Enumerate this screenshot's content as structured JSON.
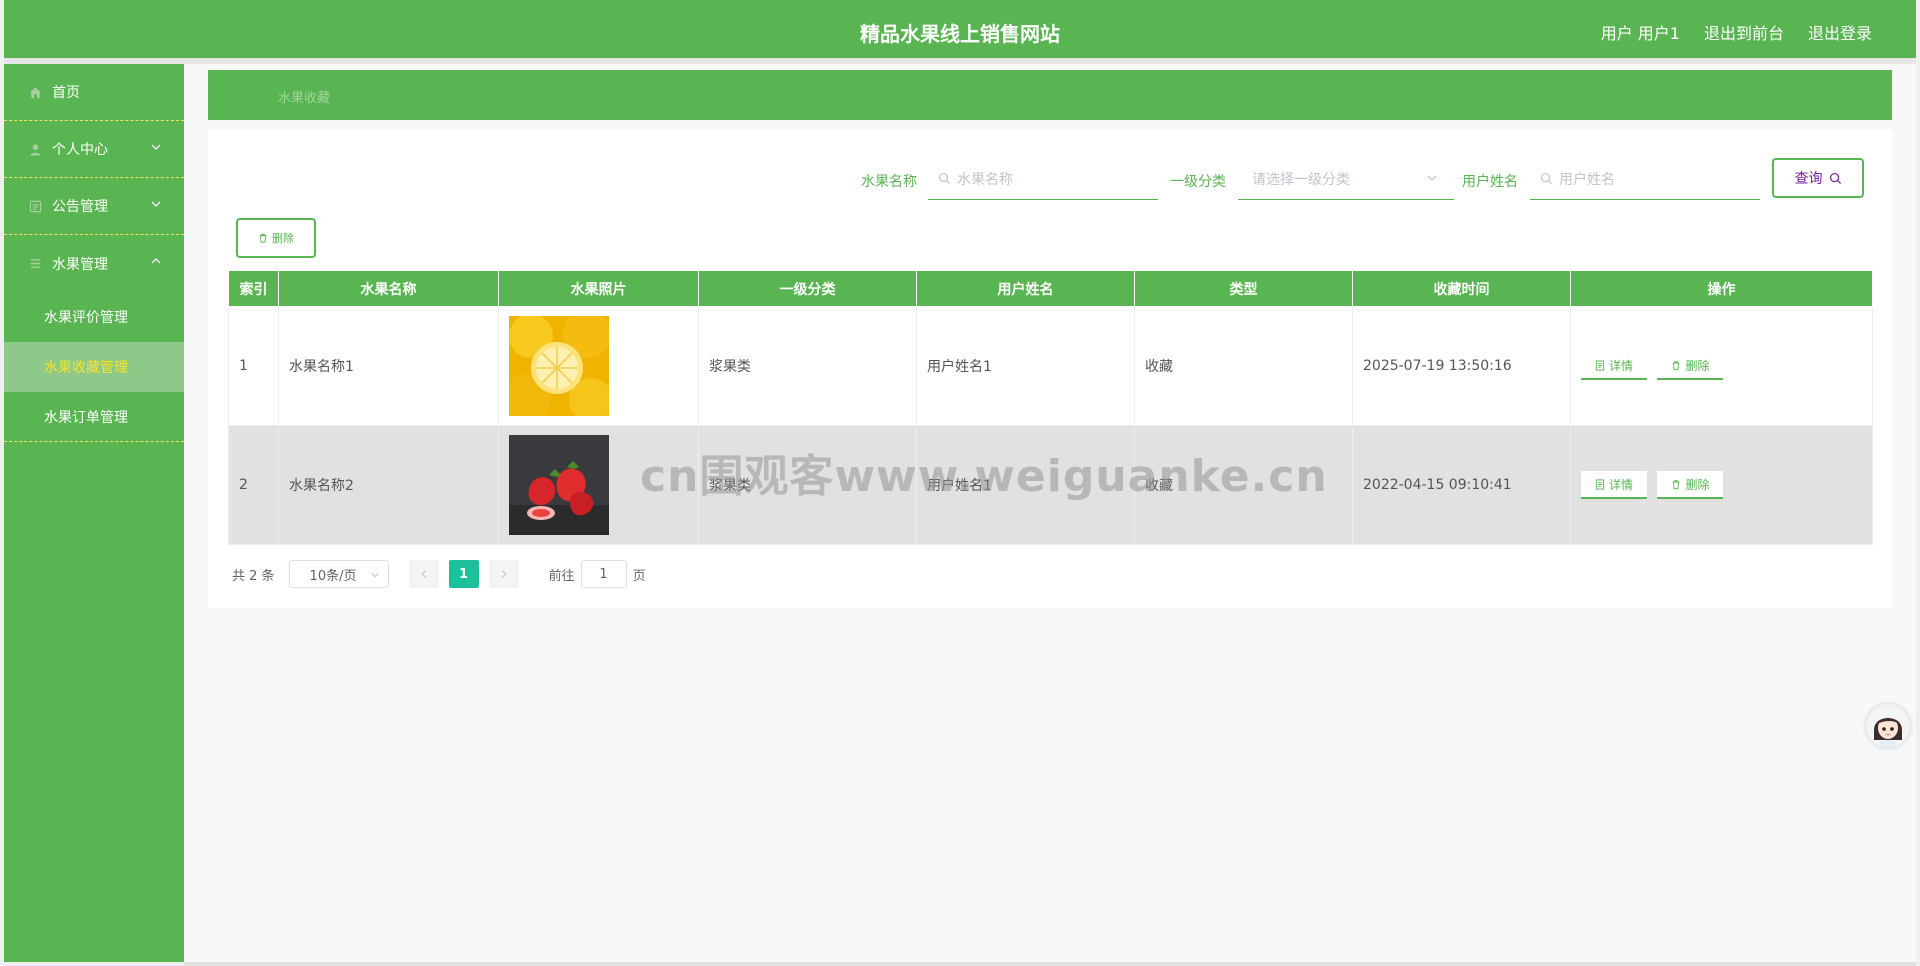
{
  "header": {
    "title": "精品水果线上销售网站",
    "user_label": "用户 用户1",
    "to_front_label": "退出到前台",
    "logout_label": "退出登录"
  },
  "sidebar": {
    "items": [
      {
        "label": "首页",
        "icon": "home-icon"
      },
      {
        "label": "个人中心",
        "icon": "user-icon"
      },
      {
        "label": "公告管理",
        "icon": "notice-icon"
      },
      {
        "label": "水果管理",
        "icon": "list-icon"
      }
    ],
    "subitems": [
      {
        "label": "水果评价管理"
      },
      {
        "label": "水果收藏管理"
      },
      {
        "label": "水果订单管理"
      }
    ]
  },
  "breadcrumb": {
    "label": "水果收藏"
  },
  "search": {
    "name_label": "水果名称",
    "name_placeholder": "水果名称",
    "category_label": "一级分类",
    "category_placeholder": "请选择一级分类",
    "user_label": "用户姓名",
    "user_placeholder": "用户姓名",
    "query_label": "查询"
  },
  "toolbar": {
    "delete_label": "删除"
  },
  "table": {
    "headers": [
      "索引",
      "水果名称",
      "水果照片",
      "一级分类",
      "用户姓名",
      "类型",
      "收藏时间",
      "操作"
    ],
    "rows": [
      {
        "index": "1",
        "name": "水果名称1",
        "photo": "lemon-photo",
        "category": "浆果类",
        "user": "用户姓名1",
        "type": "收藏",
        "time": "2025-07-19 13:50:16"
      },
      {
        "index": "2",
        "name": "水果名称2",
        "photo": "strawberry-photo",
        "category": "浆果类",
        "user": "用户姓名1",
        "type": "收藏",
        "time": "2022-04-15 09:10:41"
      }
    ],
    "detail_label": "详情",
    "delete_label": "删除"
  },
  "pagination": {
    "total": "共 2 条",
    "page_size": "10条/页",
    "current_page": "1",
    "goto_label": "前往",
    "goto_value": "1",
    "page_suffix": "页"
  },
  "watermark": "cn围观客www.weiguanke.cn",
  "colors": {
    "primary": "#58b551",
    "active_text": "#f5e32a",
    "pager_active": "#1cc09a"
  }
}
